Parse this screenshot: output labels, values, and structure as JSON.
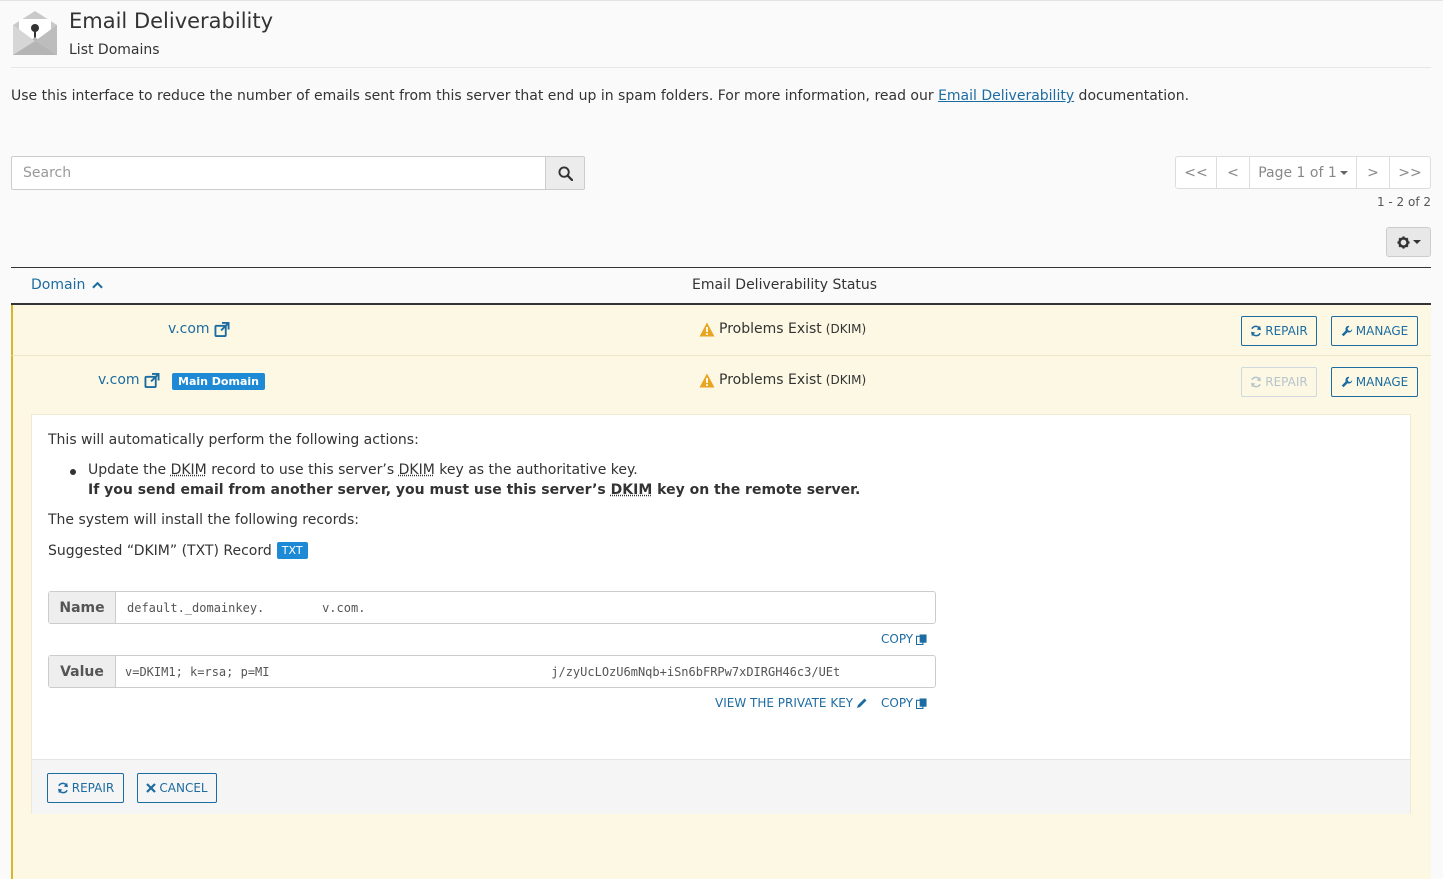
{
  "header": {
    "title": "Email Deliverability",
    "subtitle": "List Domains",
    "intro_text": "Use this interface to reduce the number of emails sent from this server that end up in spam folders. For more information, read our ",
    "intro_link": "Email Deliverability",
    "intro_suffix": " documentation."
  },
  "search": {
    "placeholder": "Search",
    "value": ""
  },
  "pager": {
    "first": "<<",
    "prev": "<",
    "page_label": "Page 1 of 1",
    "next": ">",
    "last": ">>",
    "count": "1 - 2 of 2"
  },
  "table": {
    "col_domain": "Domain",
    "col_status": "Email Deliverability Status",
    "rows": [
      {
        "domain": "v.com",
        "status": "Problems Exist",
        "status_detail": "(DKIM)",
        "repair_label": "REPAIR",
        "manage_label": "MANAGE"
      },
      {
        "domain": "v.com",
        "badge": "Main Domain",
        "status": "Problems Exist",
        "status_detail": "(DKIM)",
        "repair_label": "REPAIR",
        "manage_label": "MANAGE"
      }
    ]
  },
  "panel": {
    "intro": "This will automatically perform the following actions:",
    "bullet_a": "Update the ",
    "bullet_dkim1": "DKIM",
    "bullet_b": " record to use this server’s ",
    "bullet_dkim2": "DKIM",
    "bullet_c": " key as the authoritative key.",
    "bold_a": "If you send email from another server, you must use this server’s ",
    "bold_dkim": "DKIM",
    "bold_b": " key on the remote server.",
    "install_text": "The system will install the following records:",
    "suggested_label": "Suggested “DKIM” (TXT) Record",
    "txt_badge": "TXT",
    "name_label": "Name",
    "name_value": "default._domainkey.        v.com.",
    "value_label": "Value",
    "value_value": "v=DKIM1; k=rsa; p=MI                                       j/zyUcLOzU6mNqb+iSn6bFRPw7xDIRGH46c3/UEt",
    "copy_label": "COPY",
    "view_private_key": "VIEW THE PRIVATE KEY",
    "repair_label": "REPAIR",
    "cancel_label": "CANCEL"
  },
  "colors": {
    "link": "#1c6ca1",
    "badge": "#1e8ad6",
    "warning_row": "#fcf8e3",
    "warning_icon": "#e8a520"
  }
}
